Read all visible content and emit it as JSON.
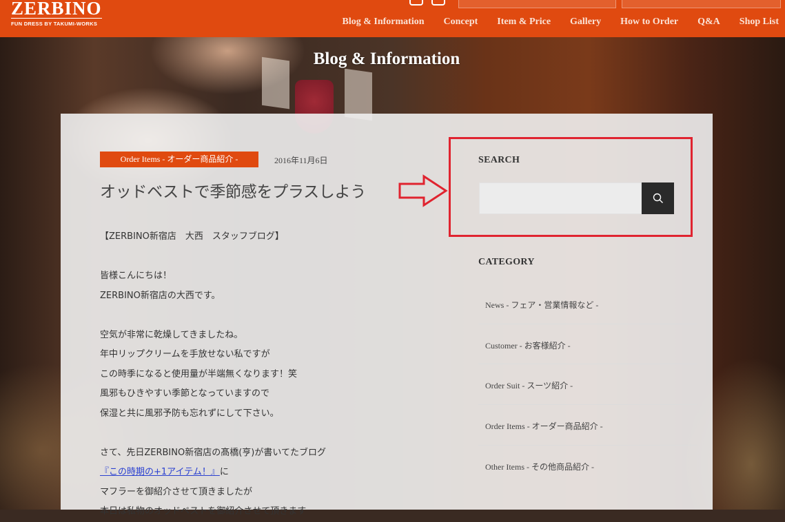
{
  "header": {
    "logo_name": "ZERBINO",
    "logo_tagline": "FUN DRESS BY TAKUMI-WORKS",
    "brand_color": "#e04a10",
    "social_icons": [
      "facebook-icon",
      "instagram-icon"
    ],
    "nav": [
      {
        "label": "Blog & Information"
      },
      {
        "label": "Concept"
      },
      {
        "label": "Item & Price"
      },
      {
        "label": "Gallery"
      },
      {
        "label": "How to Order"
      },
      {
        "label": "Q&A"
      },
      {
        "label": "Shop List"
      }
    ]
  },
  "hero": {
    "title": "Blog & Information"
  },
  "post": {
    "category": "Order Items - オーダー商品紹介 -",
    "date": "2016年11月6日",
    "title": "オッドベストで季節感をプラスしよう",
    "body": {
      "byline": "【ZERBINO新宿店　大西　スタッフブログ】",
      "greeting1": "皆様こんにちは！",
      "greeting2": "ZERBINO新宿店の大西です。",
      "para1_line1": "空気が非常に乾燥してきましたね。",
      "para1_line2": "年中リップクリームを手放せない私ですが",
      "para1_line3": "この時季になると使用量が半端無くなります！笑",
      "para1_line4": "風邪もひきやすい季節となっていますので",
      "para1_line5": "保湿と共に風邪予防も忘れずにして下さい。",
      "para2_line1": "さて、先日ZERBINO新宿店の髙橋(亨)が書いてたブログ",
      "para2_link": "『この時期の+1アイテム！』",
      "para2_link_suffix": "に",
      "para2_line3": "マフラーを御紹介させて頂きましたが",
      "para2_line4": "本日は私物のオッドベストを御紹介させて頂きます"
    }
  },
  "sidebar": {
    "search_heading": "SEARCH",
    "search_placeholder": "",
    "search_icon": "search-icon",
    "category_heading": "CATEGORY",
    "categories": [
      {
        "label": "News - フェア・営業情報など -"
      },
      {
        "label": "Customer - お客様紹介 -"
      },
      {
        "label": "Order Suit - スーツ紹介 -"
      },
      {
        "label": "Order Items - オーダー商品紹介 -"
      },
      {
        "label": "Other Items - その他商品紹介 -"
      }
    ]
  },
  "annotation": {
    "highlight_color": "#e0232f"
  }
}
